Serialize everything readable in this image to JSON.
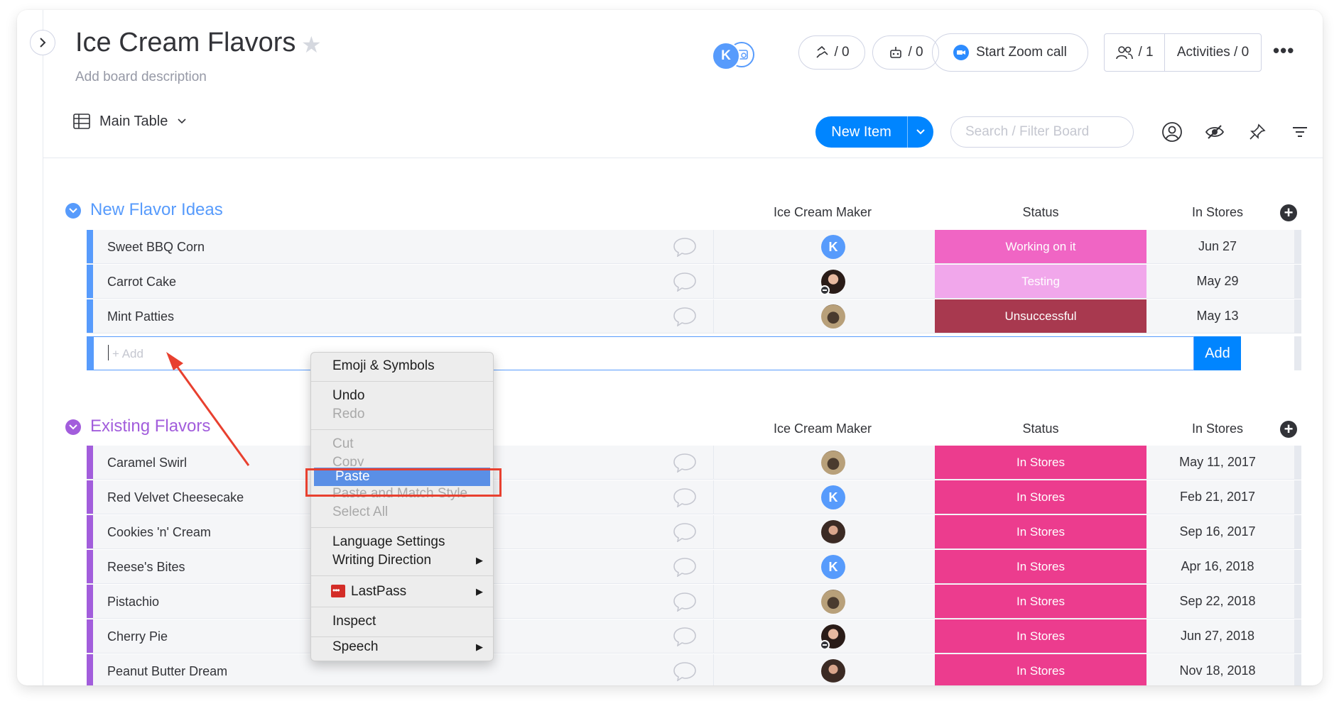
{
  "board": {
    "title": "Ice Cream Flavors",
    "description": "Add board description"
  },
  "header": {
    "avatar_initial": "K",
    "updates_count": "/ 0",
    "automations_count": "/ 0",
    "zoom_label": "Start Zoom call",
    "members_count": "/ 1",
    "activities_label": "Activities / 0"
  },
  "toolbar": {
    "view_label": "Main Table",
    "new_item_label": "New Item",
    "search_placeholder": "Search / Filter Board"
  },
  "columns": {
    "maker": "Ice Cream Maker",
    "status": "Status",
    "stores": "In Stores"
  },
  "groups": [
    {
      "title": "New Flavor Ideas",
      "color": "#579bfc",
      "rows": [
        {
          "name": "Sweet BBQ Corn",
          "maker": "K",
          "status": "Working on it",
          "status_color": "#f065c4",
          "date": "Jun 27"
        },
        {
          "name": "Carrot Cake",
          "maker": "woman-avatar",
          "status": "Testing",
          "status_color": "#f1a7eb",
          "date": "May 29"
        },
        {
          "name": "Mint Patties",
          "maker": "pug-avatar",
          "status": "Unsuccessful",
          "status_color": "#a8394f",
          "date": "May 13"
        }
      ],
      "add_placeholder": "+ Add",
      "add_button": "Add"
    },
    {
      "title": "Existing Flavors",
      "color": "#a25ddc",
      "rows": [
        {
          "name": "Caramel Swirl",
          "maker": "pug-avatar",
          "status": "In Stores",
          "status_color": "#ec3c8e",
          "date": "May 11, 2017"
        },
        {
          "name": "Red Velvet Cheesecake",
          "maker": "K",
          "status": "In Stores",
          "status_color": "#ec3c8e",
          "date": "Feb 21, 2017"
        },
        {
          "name": "Cookies 'n' Cream",
          "maker": "woman2-avatar",
          "status": "In Stores",
          "status_color": "#ec3c8e",
          "date": "Sep 16, 2017"
        },
        {
          "name": "Reese's Bites",
          "maker": "K",
          "status": "In Stores",
          "status_color": "#ec3c8e",
          "date": "Apr 16, 2018"
        },
        {
          "name": "Pistachio",
          "maker": "pug-avatar",
          "status": "In Stores",
          "status_color": "#ec3c8e",
          "date": "Sep 22, 2018"
        },
        {
          "name": "Cherry Pie",
          "maker": "woman-avatar",
          "status": "In Stores",
          "status_color": "#ec3c8e",
          "date": "Jun 27, 2018"
        },
        {
          "name": "Peanut Butter Dream",
          "maker": "woman2-avatar",
          "status": "In Stores",
          "status_color": "#ec3c8e",
          "date": "Nov 18, 2018"
        }
      ]
    }
  ],
  "context_menu": {
    "items": [
      {
        "label": "Emoji & Symbols",
        "disabled": false
      },
      {
        "label": "Undo",
        "disabled": false
      },
      {
        "label": "Redo",
        "disabled": true
      },
      {
        "label": "Cut",
        "disabled": true
      },
      {
        "label": "Copy",
        "disabled": true
      },
      {
        "label": "Paste",
        "disabled": false,
        "highlighted": true
      },
      {
        "label": "Paste and Match Style",
        "disabled": true
      },
      {
        "label": "Select All",
        "disabled": true
      },
      {
        "label": "Language Settings",
        "disabled": false
      },
      {
        "label": "Writing Direction",
        "disabled": false,
        "submenu": true
      },
      {
        "label": "LastPass",
        "disabled": false,
        "submenu": true
      },
      {
        "label": "Inspect",
        "disabled": false
      },
      {
        "label": "Speech",
        "disabled": false,
        "submenu": true
      }
    ]
  },
  "colors": {
    "accent": "#0085ff",
    "annotation": "#e8402f"
  }
}
